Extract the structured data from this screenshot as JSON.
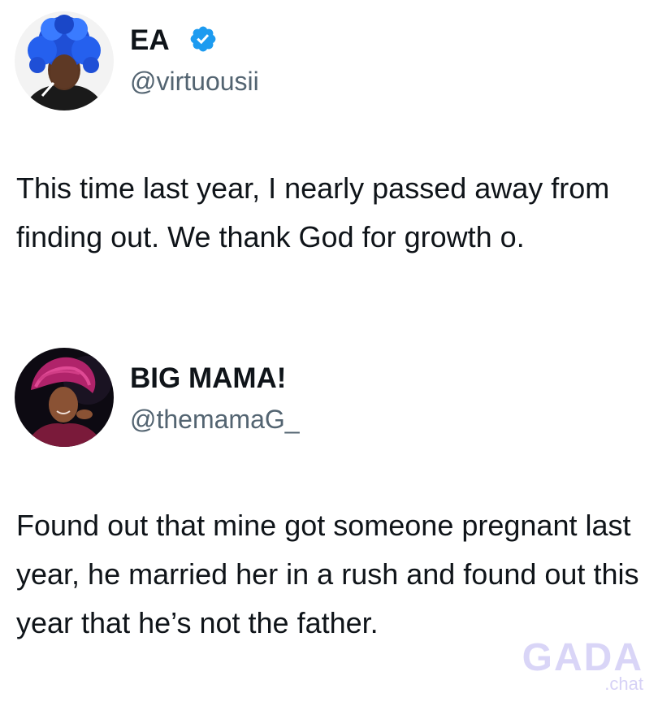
{
  "tweets": [
    {
      "display_name": "EA",
      "verified": true,
      "handle": "@virtuousii",
      "text": "This time last year, I nearly passed away from finding out. We thank God for growth o.",
      "avatar_icon": "profile-photo-blue-hair",
      "accent_color": "#1d9bf0"
    },
    {
      "display_name": "BIG MAMA!",
      "verified": false,
      "handle": "@themamaG_",
      "text": "Found out that mine got someone pregnant last year, he married her in a rush and found out this year that he’s not the father.",
      "avatar_icon": "profile-photo-pink-gele"
    }
  ],
  "watermark": {
    "brand": "GADA",
    "sub": ".chat"
  }
}
